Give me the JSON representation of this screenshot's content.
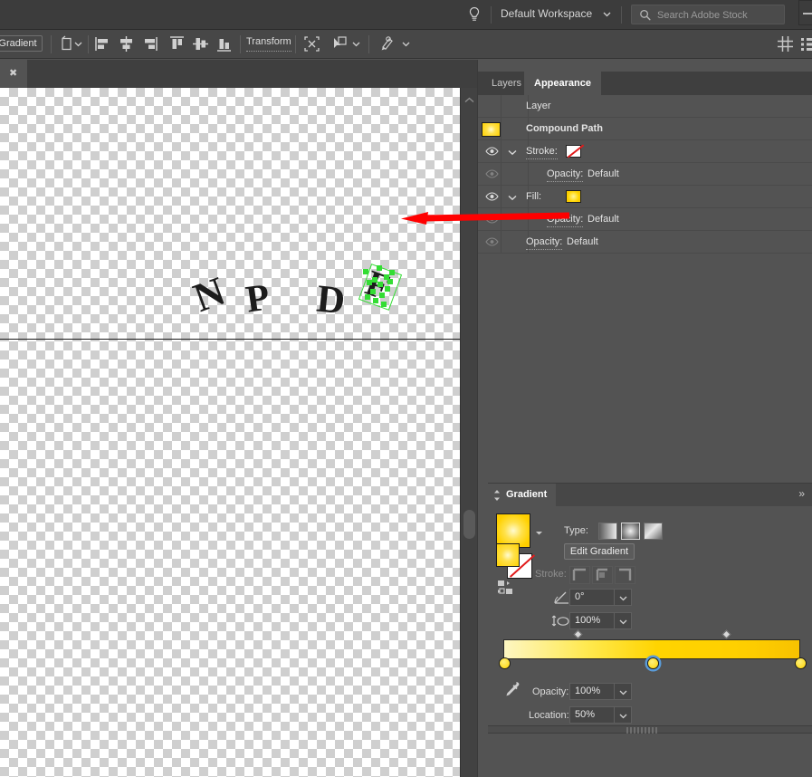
{
  "topbar": {
    "help_icon": "lightbulb-icon",
    "workspace": "Default Workspace",
    "workspace_chevron": "chevron-down-icon",
    "search_icon": "search-icon",
    "search_placeholder": "Search Adobe Stock",
    "search_value": "",
    "minimize_label": "minimize-icon"
  },
  "control_bar": {
    "gradient_button": "Gradient",
    "artboard_icon": "artboard-icon",
    "align_left": "align-left-icon",
    "align_center_h": "align-center-horizontal-icon",
    "align_right": "align-right-icon",
    "align_top": "align-top-icon",
    "align_center_v": "align-center-vertical-icon",
    "align_bottom": "align-bottom-icon",
    "transform_label": "Transform",
    "isolate_icon": "isolate-selection-icon",
    "select_similar_icon": "select-similar-icon",
    "recolor_icon": "recolor-artwork-icon",
    "distribute_spacing_icon": "distribute-spacing-icon",
    "align_panel_icon": "align-options-icon"
  },
  "document_tab": {
    "close_icon": "close-icon"
  },
  "canvas": {
    "letters": [
      "N",
      "P",
      "D",
      "F"
    ],
    "selected_letter": "F",
    "anchor_color": "#33dd33",
    "annotation_arrow": {
      "color": "#ff0000",
      "direction": "left"
    },
    "scrollbar": {
      "up_arrow_icon": "scroll-up-icon"
    }
  },
  "appearance_panel": {
    "tabs": [
      {
        "label": "Layers",
        "active": false
      },
      {
        "label": "Appearance",
        "active": true
      }
    ],
    "rows": [
      {
        "label": "Layer",
        "indent": 53,
        "eye": false,
        "chevron": false,
        "swatch": "none",
        "value": ""
      },
      {
        "label": "Compound Path",
        "indent": 53,
        "eye": false,
        "chevron": false,
        "swatch": "object",
        "value": "",
        "bold": true
      },
      {
        "label": "Stroke:",
        "indent": 53,
        "eye": true,
        "chevron": true,
        "swatch": "stroke-none",
        "value": ""
      },
      {
        "label": "Opacity:",
        "indent": 76,
        "eye": true,
        "dim": true,
        "chevron": false,
        "swatch": "none",
        "value": "Default"
      },
      {
        "label": "Fill:",
        "indent": 53,
        "eye": true,
        "chevron": true,
        "swatch": "fill-gradient",
        "value": ""
      },
      {
        "label": "Opacity:",
        "indent": 76,
        "eye": true,
        "dim": true,
        "chevron": false,
        "swatch": "none",
        "value": "Default"
      },
      {
        "label": "Opacity:",
        "indent": 53,
        "eye": true,
        "dim": true,
        "chevron": false,
        "swatch": "none",
        "value": "Default"
      }
    ]
  },
  "gradient_panel": {
    "title": "Gradient",
    "collapse_icon": "updown-arrows-icon",
    "menu_icon": "panel-menu-icon",
    "swatch_dropdown_icon": "chevron-down-icon",
    "reverse_icon": "reverse-gradient-icon",
    "fill_stroke_icon": "fill-stroke-swatch",
    "type_label": "Type:",
    "types": [
      {
        "name": "linear-gradient-icon",
        "selected": false
      },
      {
        "name": "radial-gradient-icon",
        "selected": true
      },
      {
        "name": "freeform-gradient-icon",
        "selected": false
      }
    ],
    "edit_gradient_button": "Edit Gradient",
    "stroke_label": "Stroke:",
    "stroke_types": [
      "stroke-within-icon",
      "stroke-along-icon",
      "stroke-across-icon"
    ],
    "angle_icon": "angle-icon",
    "angle_value": "0°",
    "aspect_icon": "aspect-ratio-icon",
    "aspect_value": "100%",
    "slider": {
      "stops": [
        {
          "location": 0,
          "color": "#fdf6c2",
          "selected": false
        },
        {
          "location": 50,
          "color": "#ffd400",
          "selected": true
        },
        {
          "location": 100,
          "color": "#f8c200",
          "selected": false
        }
      ],
      "midpoints": [
        25,
        75
      ]
    },
    "eyedropper_icon": "eyedropper-icon",
    "opacity_label": "Opacity:",
    "opacity_value": "100%",
    "location_label": "Location:",
    "location_value": "50%",
    "dropdown_icon": "chevron-down-icon",
    "resize_grip": "resize-grip"
  }
}
